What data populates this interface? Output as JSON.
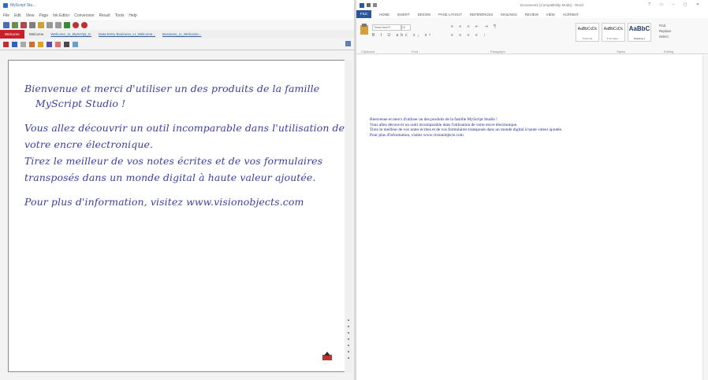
{
  "left_app": {
    "title": "MyScript Stu...",
    "menu": [
      "File",
      "Edit",
      "View",
      "Page",
      "Ink Editor",
      "Conversion",
      "Result",
      "Tools",
      "Help"
    ],
    "tabs": {
      "active": "Welcome",
      "items": [
        "Welcome",
        "Welcome_to_MyScript_S.",
        "Data Entry Business_Lt_Welcome...",
        "Business_Lt_Welcome..."
      ]
    },
    "handwriting": [
      "Bienvenue et merci d'utiliser un des produits de la famille",
      "MyScript Studio !",
      "Vous allez découvrir un outil incomparable dans l'utilisation de",
      "votre encre électronique.",
      "Tirez le meilleur de vos notes écrites et de vos formulaires",
      "transposés dans un monde digital à haute valeur ajoutée.",
      "Pour plus d'information, visitez www.visionobjects.com"
    ]
  },
  "word": {
    "doc_title": "Document1 [Compatibility Mode] - Word",
    "tabs": [
      "FILE",
      "HOME",
      "INSERT",
      "DESIGN",
      "PAGE LAYOUT",
      "REFERENCES",
      "MAILINGS",
      "REVIEW",
      "VIEW",
      "ACROBAT"
    ],
    "font_name": "Times New R...",
    "font_size": "10",
    "groups": [
      "Clipboard",
      "Font",
      "Paragraph",
      "Styles",
      "Editing"
    ],
    "styles": [
      {
        "sample": "AaBbCcDc",
        "name": "¶ Normal"
      },
      {
        "sample": "AaBbCcDc",
        "name": "¶ No Spac..."
      },
      {
        "sample": "AaBbC",
        "name": "Heading 1"
      }
    ],
    "editing": [
      "Find",
      "Replace",
      "Select"
    ],
    "document_lines": [
      "Bienvenue et merci d'utiliser un des produits de la famille MyScript Studio !",
      "Vous allez découvrir un outil incomparable dans l'utilisation de votre encre électronique.",
      "Tirez le meilleur de vos notes écrites et de vos formulaires transposés dans un monde digital à haute valeur ajoutée.",
      "Pour plus d'information, visitez www.visionobjects.com"
    ]
  },
  "colors": {
    "ink": "#3b3fa0",
    "word_text": "#1e2a88",
    "accent_red": "#c8202a",
    "word_blue": "#2b579a"
  }
}
